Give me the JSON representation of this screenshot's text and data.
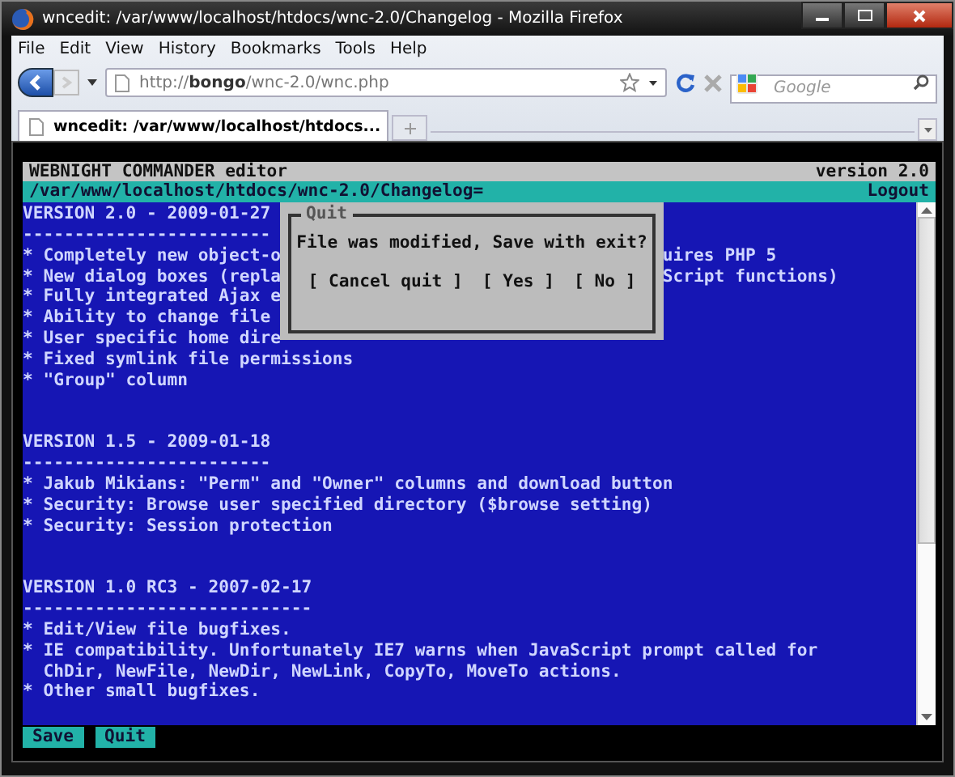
{
  "window": {
    "title": "wncedit: /var/www/localhost/htdocs/wnc-2.0/Changelog - Mozilla Firefox"
  },
  "menu": [
    "File",
    "Edit",
    "View",
    "History",
    "Bookmarks",
    "Tools",
    "Help"
  ],
  "address": {
    "value": "http://**bongo**/wnc-2.0/wnc.php"
  },
  "search": {
    "placeholder": "Google"
  },
  "tabs": [
    {
      "label": "wncedit: /var/www/localhost/htdocs...",
      "selected": true
    }
  ],
  "app": {
    "title": "WEBNIGHT COMMANDER editor",
    "version": "version 2.0",
    "path": "/var/www/localhost/htdocs/wnc-2.0/Changelog=",
    "logout": "Logout"
  },
  "sections": [
    {
      "heading": "VERSION 2.0 - 2009-01-27",
      "rule": "------------------------",
      "lines": [
        {
          "text": "* Completely new object-o",
          "tail": "uires PHP 5"
        },
        {
          "text": "* New dialog boxes (repla",
          "tail": "Script functions)"
        },
        {
          "text": "* Fully integrated Ajax e"
        },
        {
          "text": "* Ability to change file"
        },
        {
          "text": "* User specific home dire"
        },
        {
          "text": "* Fixed symlink file permissions"
        },
        {
          "text": "* \"Group\" column"
        }
      ]
    },
    {
      "heading": "VERSION 1.5 - 2009-01-18",
      "rule": "------------------------",
      "lines": [
        {
          "text": "* Jakub Mikians: \"Perm\" and \"Owner\" columns and download button"
        },
        {
          "text": "* Security: Browse user specified directory ($browse setting)"
        },
        {
          "text": "* Security: Session protection"
        }
      ]
    },
    {
      "heading": "VERSION 1.0 RC3 - 2007-02-17",
      "rule": "----------------------------",
      "lines": [
        {
          "text": "* Edit/View file bugfixes."
        },
        {
          "text": "* IE compatibility. Unfortunately IE7 warns when JavaScript prompt called for"
        },
        {
          "text": "  ChDir, NewFile, NewDir, NewLink, CopyTo, MoveTo actions."
        },
        {
          "text": "* Other small bugfixes."
        }
      ]
    }
  ],
  "dialog": {
    "title": "Quit",
    "message": "File was modified, Save with exit?",
    "buttons": [
      "[ Cancel quit ]",
      "[ Yes ]",
      "[ No ]"
    ]
  },
  "actions": [
    "Save",
    "Quit"
  ]
}
